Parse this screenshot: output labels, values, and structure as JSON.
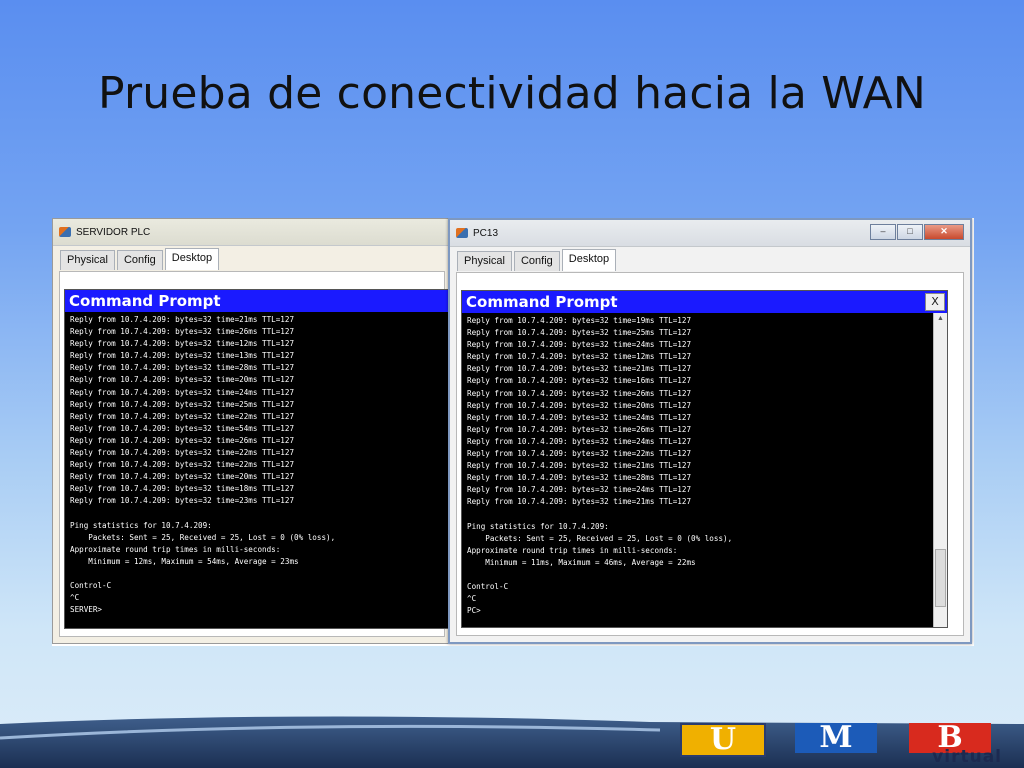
{
  "slide": {
    "title": "Prueba de conectividad hacia la WAN"
  },
  "left_window": {
    "title": "SERVIDOR PLC",
    "tabs": [
      "Physical",
      "Config",
      "Desktop"
    ],
    "active_tab": "Desktop",
    "prompt_title": "Command Prompt",
    "lines": [
      "Reply from 10.7.4.209: bytes=32 time=21ms TTL=127",
      "Reply from 10.7.4.209: bytes=32 time=26ms TTL=127",
      "Reply from 10.7.4.209: bytes=32 time=12ms TTL=127",
      "Reply from 10.7.4.209: bytes=32 time=13ms TTL=127",
      "Reply from 10.7.4.209: bytes=32 time=28ms TTL=127",
      "Reply from 10.7.4.209: bytes=32 time=20ms TTL=127",
      "Reply from 10.7.4.209: bytes=32 time=24ms TTL=127",
      "Reply from 10.7.4.209: bytes=32 time=25ms TTL=127",
      "Reply from 10.7.4.209: bytes=32 time=22ms TTL=127",
      "Reply from 10.7.4.209: bytes=32 time=54ms TTL=127",
      "Reply from 10.7.4.209: bytes=32 time=26ms TTL=127",
      "Reply from 10.7.4.209: bytes=32 time=22ms TTL=127",
      "Reply from 10.7.4.209: bytes=32 time=22ms TTL=127",
      "Reply from 10.7.4.209: bytes=32 time=20ms TTL=127",
      "Reply from 10.7.4.209: bytes=32 time=18ms TTL=127",
      "Reply from 10.7.4.209: bytes=32 time=23ms TTL=127",
      "",
      "Ping statistics for 10.7.4.209:",
      "    Packets: Sent = 25, Received = 25, Lost = 0 (0% loss),",
      "Approximate round trip times in milli-seconds:",
      "    Minimum = 12ms, Maximum = 54ms, Average = 23ms",
      "",
      "Control-C",
      "^C",
      "SERVER>"
    ]
  },
  "right_window": {
    "title": "PC13",
    "tabs": [
      "Physical",
      "Config",
      "Desktop"
    ],
    "active_tab": "Desktop",
    "prompt_title": "Command Prompt",
    "close_label": "X",
    "lines": [
      "Reply from 10.7.4.209: bytes=32 time=19ms TTL=127",
      "Reply from 10.7.4.209: bytes=32 time=25ms TTL=127",
      "Reply from 10.7.4.209: bytes=32 time=24ms TTL=127",
      "Reply from 10.7.4.209: bytes=32 time=12ms TTL=127",
      "Reply from 10.7.4.209: bytes=32 time=21ms TTL=127",
      "Reply from 10.7.4.209: bytes=32 time=16ms TTL=127",
      "Reply from 10.7.4.209: bytes=32 time=26ms TTL=127",
      "Reply from 10.7.4.209: bytes=32 time=20ms TTL=127",
      "Reply from 10.7.4.209: bytes=32 time=24ms TTL=127",
      "Reply from 10.7.4.209: bytes=32 time=26ms TTL=127",
      "Reply from 10.7.4.209: bytes=32 time=24ms TTL=127",
      "Reply from 10.7.4.209: bytes=32 time=22ms TTL=127",
      "Reply from 10.7.4.209: bytes=32 time=21ms TTL=127",
      "Reply from 10.7.4.209: bytes=32 time=28ms TTL=127",
      "Reply from 10.7.4.209: bytes=32 time=24ms TTL=127",
      "Reply from 10.7.4.209: bytes=32 time=21ms TTL=127",
      "",
      "Ping statistics for 10.7.4.209:",
      "    Packets: Sent = 25, Received = 25, Lost = 0 (0% loss),",
      "Approximate round trip times in milli-seconds:",
      "    Minimum = 11ms, Maximum = 46ms, Average = 22ms",
      "",
      "Control-C",
      "^C",
      "PC>"
    ]
  },
  "logo": {
    "letters": [
      "U",
      "M",
      "B"
    ],
    "tagline": "virtual"
  },
  "colors": {
    "prompt_header": "#1a1aff",
    "terminal_bg": "#000000",
    "logo_u": "#f0b000",
    "logo_m": "#1c5bb8",
    "logo_b": "#d82a1e"
  }
}
